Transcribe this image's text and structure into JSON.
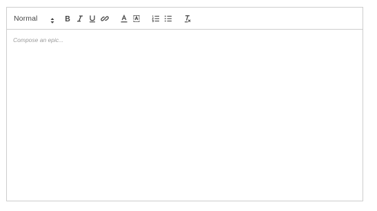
{
  "toolbar": {
    "header_select": {
      "value": "Normal"
    },
    "buttons": [
      {
        "name": "bold",
        "icon": "bold-icon"
      },
      {
        "name": "italic",
        "icon": "italic-icon"
      },
      {
        "name": "underline",
        "icon": "underline-icon"
      },
      {
        "name": "link",
        "icon": "link-icon"
      },
      {
        "name": "font-color",
        "icon": "font-color-icon"
      },
      {
        "name": "background-color",
        "icon": "background-color-icon"
      },
      {
        "name": "ordered-list",
        "icon": "ordered-list-icon"
      },
      {
        "name": "bullet-list",
        "icon": "bullet-list-icon"
      },
      {
        "name": "clear-formatting",
        "icon": "clear-formatting-icon"
      }
    ]
  },
  "editor": {
    "placeholder": "Compose an epic...",
    "content": ""
  },
  "colors": {
    "border": "#cccccc",
    "icon": "#444444",
    "placeholder": "#9a9a9a"
  }
}
